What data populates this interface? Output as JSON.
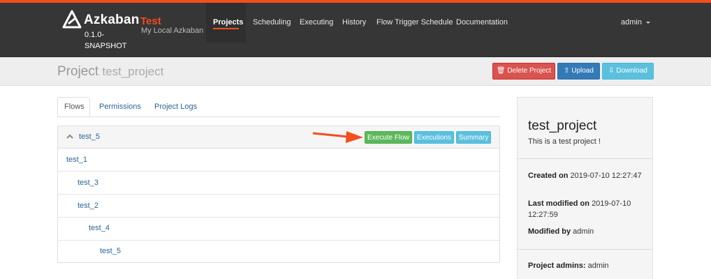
{
  "navbar": {
    "brand": "Azkaban",
    "version": "0.1.0-SNAPSHOT",
    "env_name": "Test",
    "env_desc": "My Local Azkaban",
    "items": [
      {
        "label": "Projects",
        "active": true
      },
      {
        "label": "Scheduling"
      },
      {
        "label": "Executing"
      },
      {
        "label": "History"
      },
      {
        "label": "Flow Trigger Schedule"
      },
      {
        "label": "Documentation"
      }
    ],
    "user": "admin",
    "accent": "#f24e1e"
  },
  "header": {
    "title_prefix": "Project",
    "project_name": "test_project",
    "buttons": {
      "delete": "Delete Project",
      "upload": "Upload",
      "download": "Download"
    }
  },
  "tabs": [
    {
      "label": "Flows",
      "active": true
    },
    {
      "label": "Permissions"
    },
    {
      "label": "Project Logs"
    }
  ],
  "flow": {
    "name": "test_5",
    "buttons": {
      "execute": "Execute Flow",
      "executions": "Executions",
      "summary": "Summary"
    },
    "jobs": [
      {
        "name": "test_1"
      },
      {
        "name": "test_3"
      },
      {
        "name": "test_2"
      },
      {
        "name": "test_4"
      },
      {
        "name": "test_5"
      }
    ]
  },
  "sidebar": {
    "project_name": "test_project",
    "description": "This is a test project !",
    "created_label": "Created on",
    "created_value": "2019-07-10 12:27:47",
    "modified_label": "Last modified on",
    "modified_value": "2019-07-10 12:27:59",
    "modified_by_label": "Modified by",
    "modified_by_value": "admin",
    "admins_label": "Project admins:",
    "admins_value": "admin"
  }
}
